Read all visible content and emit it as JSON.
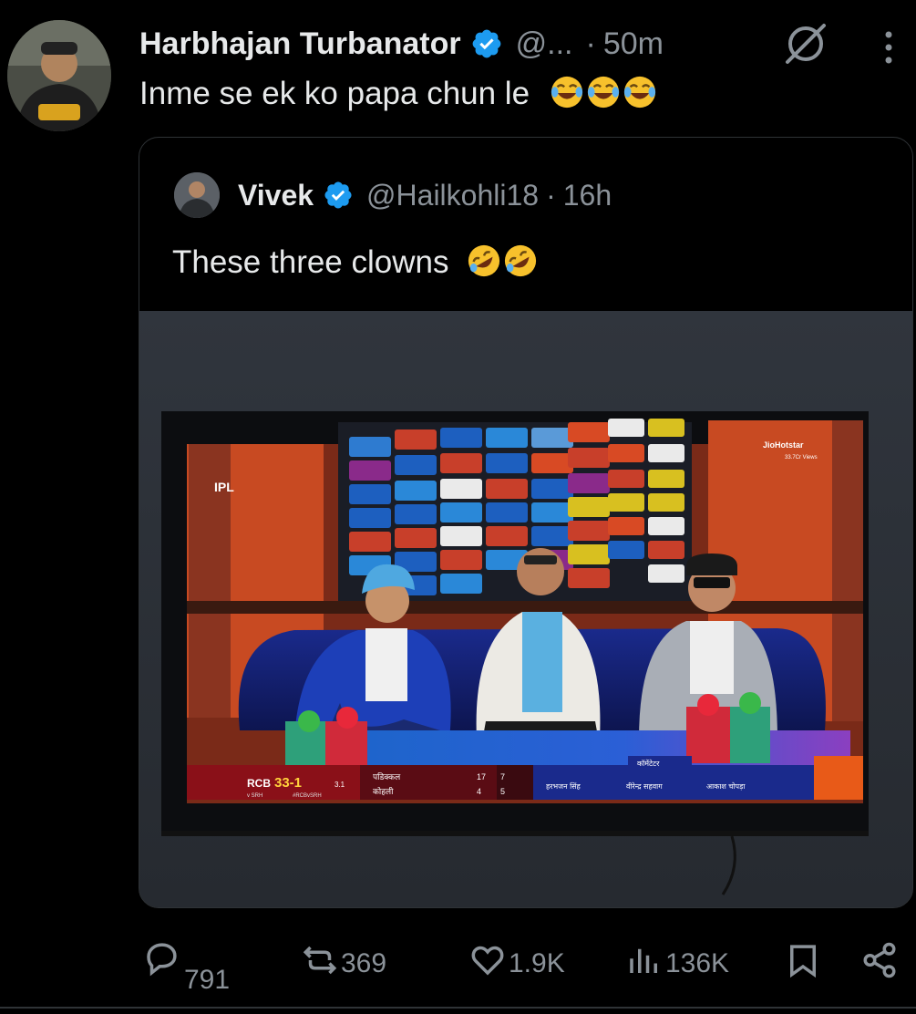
{
  "tweet": {
    "author_name": "Harbhajan Turbanator",
    "handle": "@...",
    "separator": "·",
    "time": "50m",
    "text": "Inme se ek ko papa chun le"
  },
  "quoted_tweet": {
    "author_name": "Vivek",
    "handle": "@Hailkohli18",
    "separator": "·",
    "time": "16h",
    "text": "These three clowns"
  },
  "broadcast": {
    "channel": "JioHotstar",
    "views": "33.7Cr Views",
    "league": "IPL",
    "team": "RCB",
    "score": "33-1",
    "overs": "3.1",
    "opponent": "v SRH",
    "tag": "#RCBvSRH",
    "batter1": "पडिक्कल",
    "batter2": "कोहली",
    "b1_runs": "17",
    "b1_balls": "7",
    "b2_runs": "4",
    "b2_balls": "5",
    "commentator_heading": "कॉमेंटेटर",
    "commentator1": "हरभजन सिंह",
    "commentator2": "वीरेन्द्र सहवाग",
    "commentator3": "आकाश चोपड़ा"
  },
  "actions": {
    "replies": "791",
    "reposts": "369",
    "likes": "1.9K",
    "views": "136K"
  },
  "colors": {
    "background": "#000000",
    "text": "#e7e9ea",
    "secondary": "#8b9299",
    "verified": "#1d9bf0",
    "border": "#2f3336"
  },
  "icons": [
    "verified-badge-icon",
    "grok-icon",
    "more-options-icon",
    "reply-icon",
    "repost-icon",
    "like-icon",
    "views-icon",
    "bookmark-icon",
    "share-icon",
    "laughing-emoji-icon",
    "rofl-emoji-icon"
  ]
}
